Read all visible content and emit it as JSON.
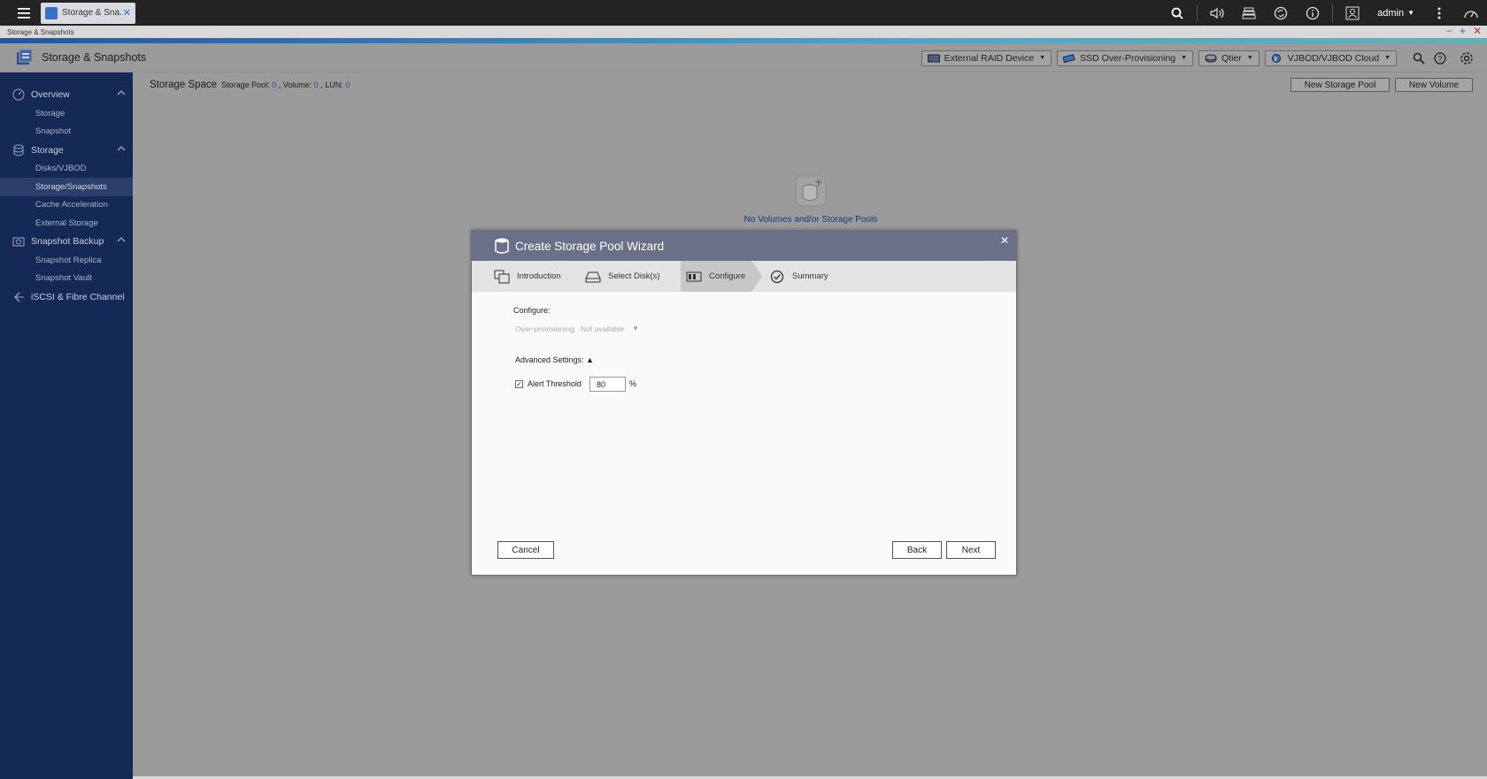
{
  "topbar": {
    "app_tab_label": "Storage & Sna...",
    "user_name": "admin"
  },
  "window": {
    "title": "Storage & Snapshots"
  },
  "app": {
    "title": "Storage & Snapshots",
    "toolbar": {
      "external_raid": "External RAID Device",
      "ssd_overprov": "SSD Over-Provisioning",
      "qtier": "Qtier",
      "vjbod": "VJBOD/VJBOD Cloud"
    }
  },
  "sidebar": {
    "sections": [
      {
        "label": "Overview",
        "items": [
          "Storage",
          "Snapshot"
        ]
      },
      {
        "label": "Storage",
        "items": [
          "Disks/VJBOD",
          "Storage/Snapshots",
          "Cache Acceleration",
          "External Storage"
        ]
      },
      {
        "label": "Snapshot Backup",
        "items": [
          "Snapshot Replica",
          "Snapshot Vault"
        ]
      },
      {
        "label": "iSCSI & Fibre Channel",
        "items": []
      }
    ],
    "active_item": "Storage/Snapshots"
  },
  "main": {
    "heading": "Storage Space",
    "pool_label": "Storage Pool:",
    "pool_count": "0",
    "volume_label": ", Volume:",
    "volume_count": "0",
    "lun_label": ", LUN:",
    "lun_count": "0",
    "new_pool_button": "New Storage Pool",
    "new_volume_button": "New Volume",
    "empty_message": "No Volumes and/or Storage Pools"
  },
  "dialog": {
    "title": "Create Storage Pool Wizard",
    "steps": [
      "Introduction",
      "Select Disk(s)",
      "Configure",
      "Summary"
    ],
    "active_step": "Configure",
    "configure_label": "Configure:",
    "overprov_label": "Over-provisioning:",
    "overprov_value": "Not available",
    "advanced_label": "Advanced Settings: ▲",
    "alert_label": "Alert Threshold",
    "alert_value": "80",
    "alert_unit": "%",
    "cancel_button": "Cancel",
    "back_button": "Back",
    "next_button": "Next"
  }
}
